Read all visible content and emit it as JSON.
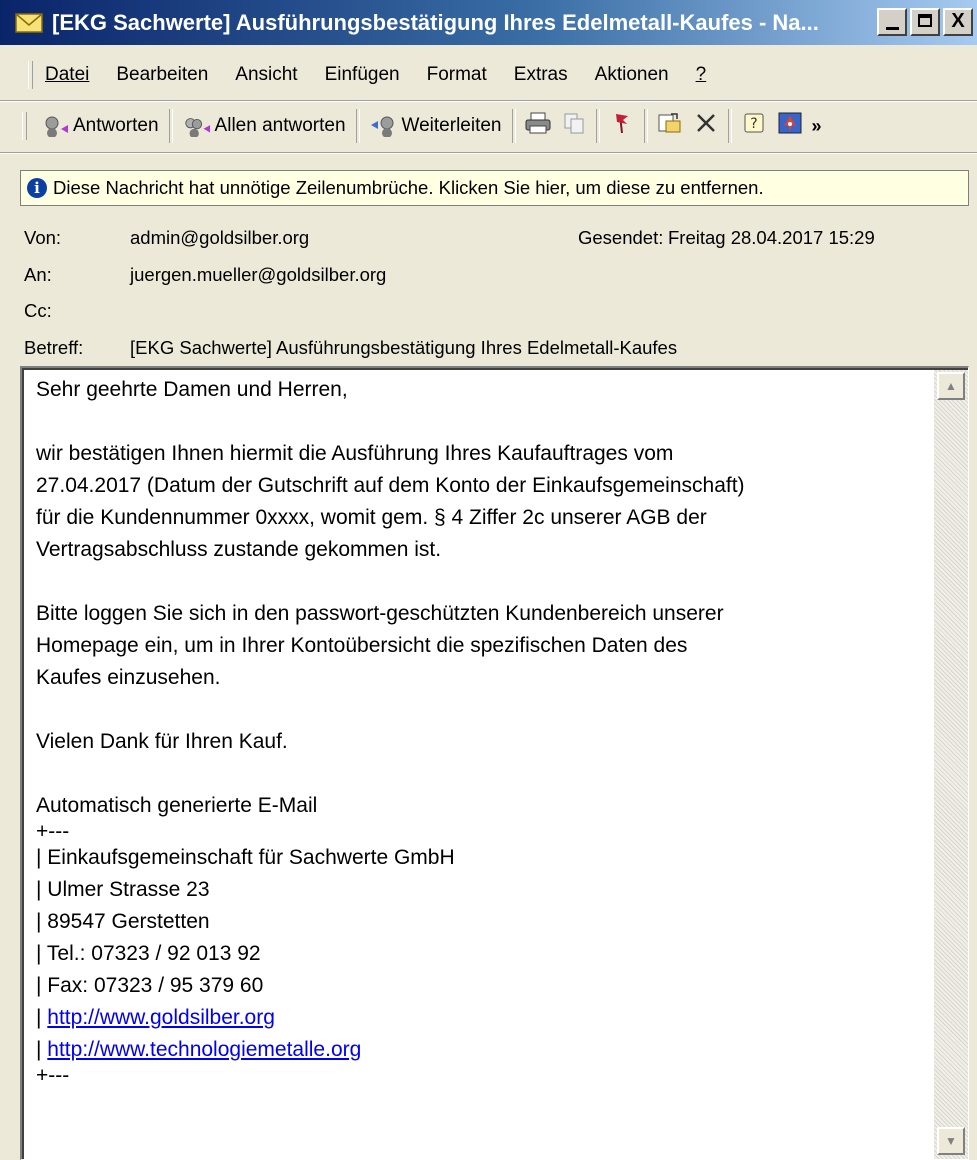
{
  "window": {
    "title": "[EKG Sachwerte] Ausführungsbestätigung Ihres Edelmetall-Kaufes - Na...",
    "minimize_label": "",
    "maximize_label": "",
    "close_label": "X"
  },
  "menu": {
    "items": [
      "Datei",
      "Bearbeiten",
      "Ansicht",
      "Einfügen",
      "Format",
      "Extras",
      "Aktionen",
      "?"
    ]
  },
  "toolbar": {
    "reply_label": "Antworten",
    "reply_all_label": "Allen antworten",
    "forward_label": "Weiterleiten",
    "chevron": "»"
  },
  "infobar": {
    "text": "Diese Nachricht hat unnötige Zeilenumbrüche. Klicken Sie hier, um diese zu entfernen."
  },
  "headers": {
    "from_label": "Von:",
    "from_value": "admin@goldsilber.org",
    "sent_label": "Gesendet:",
    "sent_value": "Freitag 28.04.2017 15:29",
    "to_label": "An:",
    "to_value": "juergen.mueller@goldsilber.org",
    "cc_label": "Cc:",
    "cc_value": "",
    "subject_label": "Betreff:",
    "subject_value": "[EKG Sachwerte] Ausführungsbestätigung Ihres Edelmetall-Kaufes"
  },
  "body": {
    "greeting": "Sehr geehrte Damen und Herren,",
    "para1": [
      "wir bestätigen Ihnen hiermit die Ausführung Ihres Kaufauftrages vom",
      "27.04.2017 (Datum der Gutschrift auf dem Konto der Einkaufsgemeinschaft)",
      "für die Kundennummer 0xxxx, womit gem. § 4 Ziffer 2c unserer AGB der",
      "Vertragsabschluss zustande gekommen ist."
    ],
    "para2": [
      "Bitte loggen Sie sich in den passwort-geschützten Kundenbereich unserer",
      "Homepage ein, um in Ihrer Kontoübersicht die spezifischen Daten des",
      "Kaufes einzusehen."
    ],
    "thanks": "Vielen Dank für Ihren Kauf.",
    "auto_note": "Automatisch generierte E-Mail",
    "sig_rule": "+---",
    "sig_company": "| Einkaufsgemeinschaft für Sachwerte GmbH",
    "sig_street": "| Ulmer Strasse 23",
    "sig_city": "| 89547 Gerstetten",
    "sig_tel": "| Tel.: 07323 / 92 013 92",
    "sig_fax": "| Fax: 07323 / 95 379 60",
    "sig_pipe": "| ",
    "link1": "http://www.goldsilber.org",
    "link2": "http://www.technologiemetalle.org",
    "sig_rule_end": "+---"
  },
  "colors": {
    "titlebar_start": "#0a246a",
    "titlebar_end": "#a6caf0",
    "infobar_bg": "#ffffe1",
    "link": "#0000ee",
    "window_bg": "#ece9d8"
  }
}
